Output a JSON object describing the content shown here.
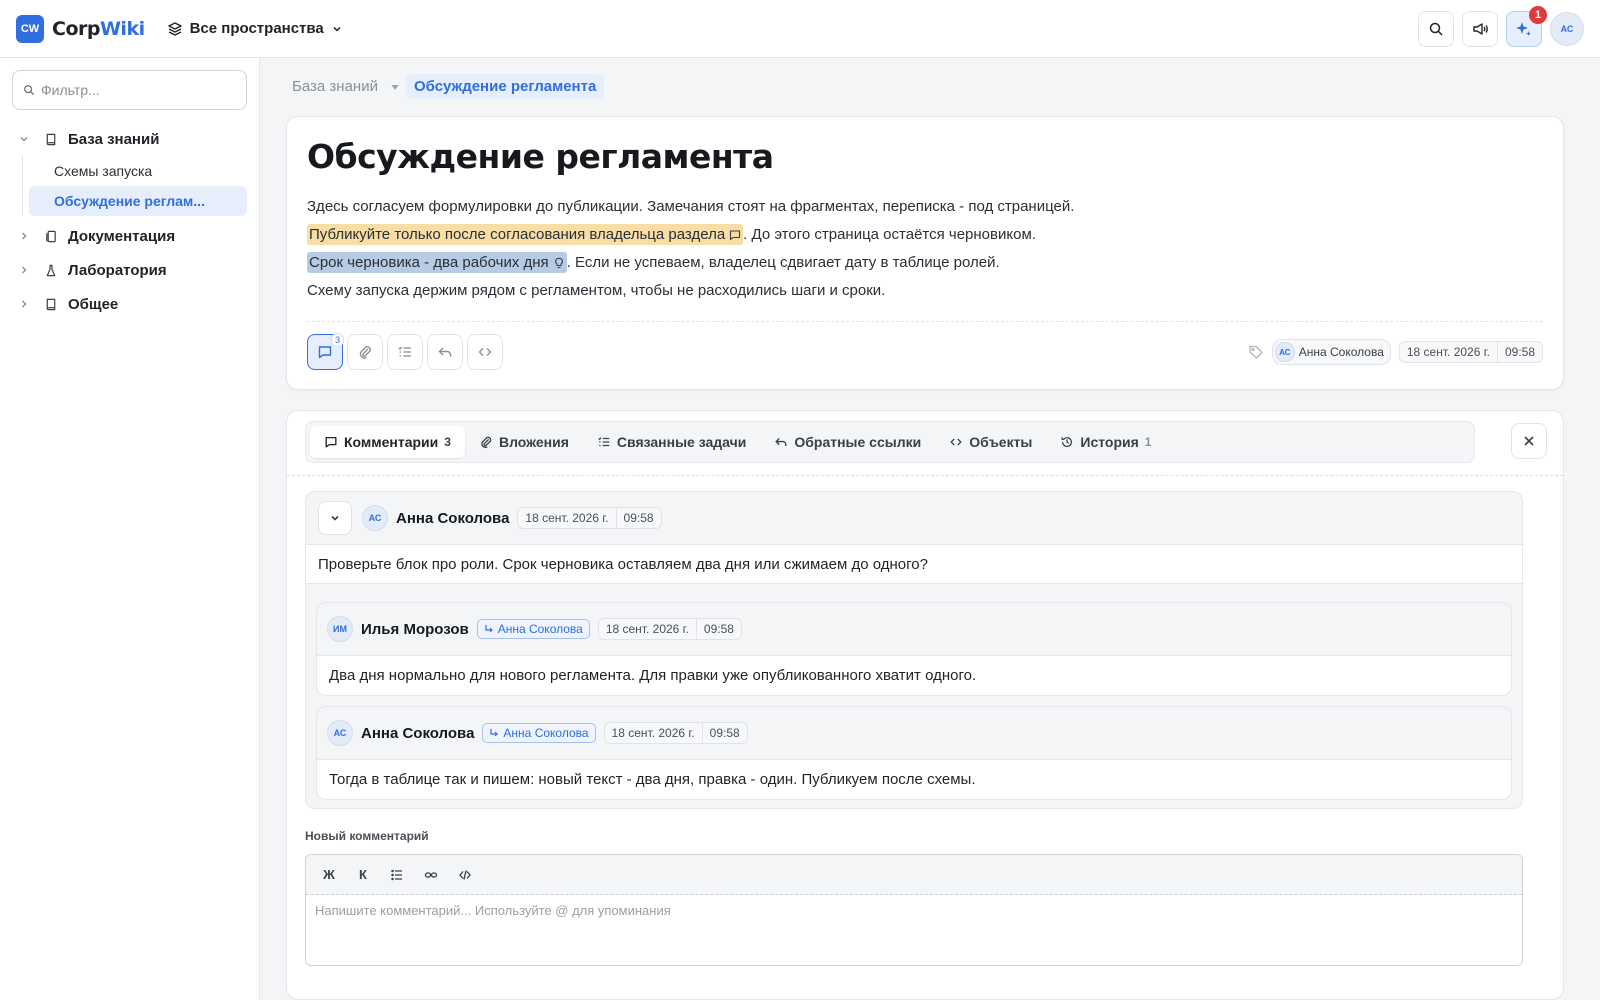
{
  "app": {
    "logo_abbr": "CW",
    "logo_part1": "Corp",
    "logo_part2": "Wiki",
    "space_selector": "Все пространства",
    "notification_count": "1",
    "user_initials": "АС"
  },
  "sidebar": {
    "filter_placeholder": "Фильтр...",
    "tree": [
      {
        "label": "База знаний",
        "expanded": true,
        "icon": "book-icon",
        "children": [
          {
            "label": "Схемы запуска"
          },
          {
            "label": "Обсуждение регламента",
            "display": "Обсуждение реглам...",
            "active": true
          }
        ]
      },
      {
        "label": "Документация",
        "icon": "documents-icon"
      },
      {
        "label": "Лаборатория",
        "icon": "flask-icon"
      },
      {
        "label": "Общее",
        "icon": "book-icon"
      }
    ]
  },
  "breadcrumb": {
    "parent": "База знаний",
    "current": "Обсуждение регламента"
  },
  "page": {
    "title": "Обсуждение регламента",
    "para1": "Здесь согласуем формулировки до публикации. Замечания стоят на фрагментах, переписка - под страницей.",
    "para2_highlight": "Публикуйте только после согласования владельца раздела",
    "para2_rest": ". До этого страница остаётся черновиком.",
    "para3_highlight": "Срок черновика - два рабочих дня",
    "para3_rest": ". Если не успеваем, владелец сдвигает дату в таблице ролей.",
    "para4": "Схему запуска держим рядом с регламентом, чтобы не расходились шаги и сроки.",
    "comments_badge": "3",
    "author_initials": "АС",
    "author": "Анна Соколова",
    "date": "18 сент. 2026 г.",
    "time": "09:58"
  },
  "tabs": [
    {
      "label": "Комментарии",
      "count": "3",
      "icon": "comment-icon",
      "active": true
    },
    {
      "label": "Вложения",
      "icon": "paperclip-icon"
    },
    {
      "label": "Связанные задачи",
      "icon": "tasklist-icon"
    },
    {
      "label": "Обратные ссылки",
      "icon": "backlink-icon"
    },
    {
      "label": "Объекты",
      "icon": "code-icon"
    },
    {
      "label": "История",
      "count": "1",
      "icon": "history-icon"
    }
  ],
  "comments": {
    "root": {
      "initials": "АС",
      "author": "Анна Соколова",
      "date": "18 сент. 2026 г.",
      "time": "09:58",
      "text": "Проверьте блок про роли. Срок черновика оставляем два дня или сжимаем до одного?"
    },
    "replies": [
      {
        "initials": "ИМ",
        "author": "Илья Морозов",
        "reply_to": "Анна Соколова",
        "date": "18 сент. 2026 г.",
        "time": "09:58",
        "text": "Два дня нормально для нового регламента. Для правки уже опубликованного хватит одного."
      },
      {
        "initials": "АС",
        "author": "Анна Соколова",
        "reply_to": "Анна Соколова",
        "date": "18 сент. 2026 г.",
        "time": "09:58",
        "text": "Тогда в таблице так и пишем: новый текст - два дня, правка - один. Публикуем после схемы."
      }
    ]
  },
  "new_comment": {
    "label": "Новый комментарий",
    "bold": "Ж",
    "italic": "К",
    "placeholder": "Напишите комментарий... Используйте @ для упоминания"
  },
  "colors": {
    "accent": "#2f6fdf",
    "highlight_yellow": "#f8dda4",
    "highlight_blue": "#b7cbe4",
    "badge_red": "#e03a3a"
  }
}
